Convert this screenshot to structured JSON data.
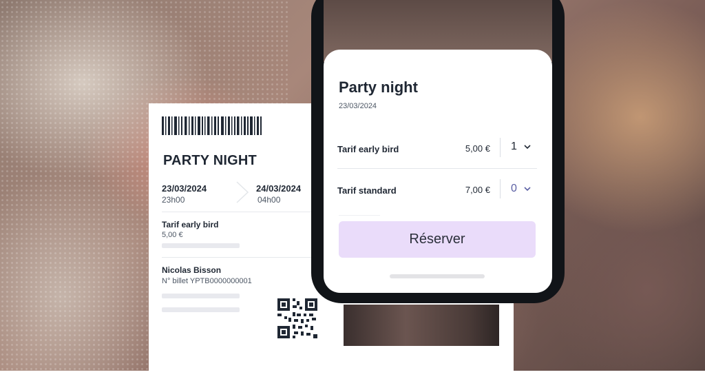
{
  "ticket": {
    "title": "PARTY NIGHT",
    "start_date": "23/03/2024",
    "start_time": "23h00",
    "end_date": "24/03/2024",
    "end_time": "04h00",
    "tariff_label": "Tarif early bird",
    "tariff_price": "5,00 €",
    "holder_name": "Nicolas Bisson",
    "ticket_number": "N° billet YPTB0000000001"
  },
  "booking": {
    "event_title": "Party night",
    "event_date": "23/03/2024",
    "tariffs": [
      {
        "label": "Tarif early bird",
        "price": "5,00 €",
        "quantity": "1"
      },
      {
        "label": "Tarif standard",
        "price": "7,00 €",
        "quantity": "0"
      }
    ],
    "reserve_label": "Réserver"
  },
  "icons": {
    "barcode": "barcode-icon",
    "qr": "qr-code-icon",
    "arrow": "chevron-right-icon",
    "dropdown": "chevron-down-icon"
  },
  "colors": {
    "reserve_button": "#eadcfa",
    "text_dark": "#1f2733",
    "quantity_zero": "#5a5fa3"
  }
}
